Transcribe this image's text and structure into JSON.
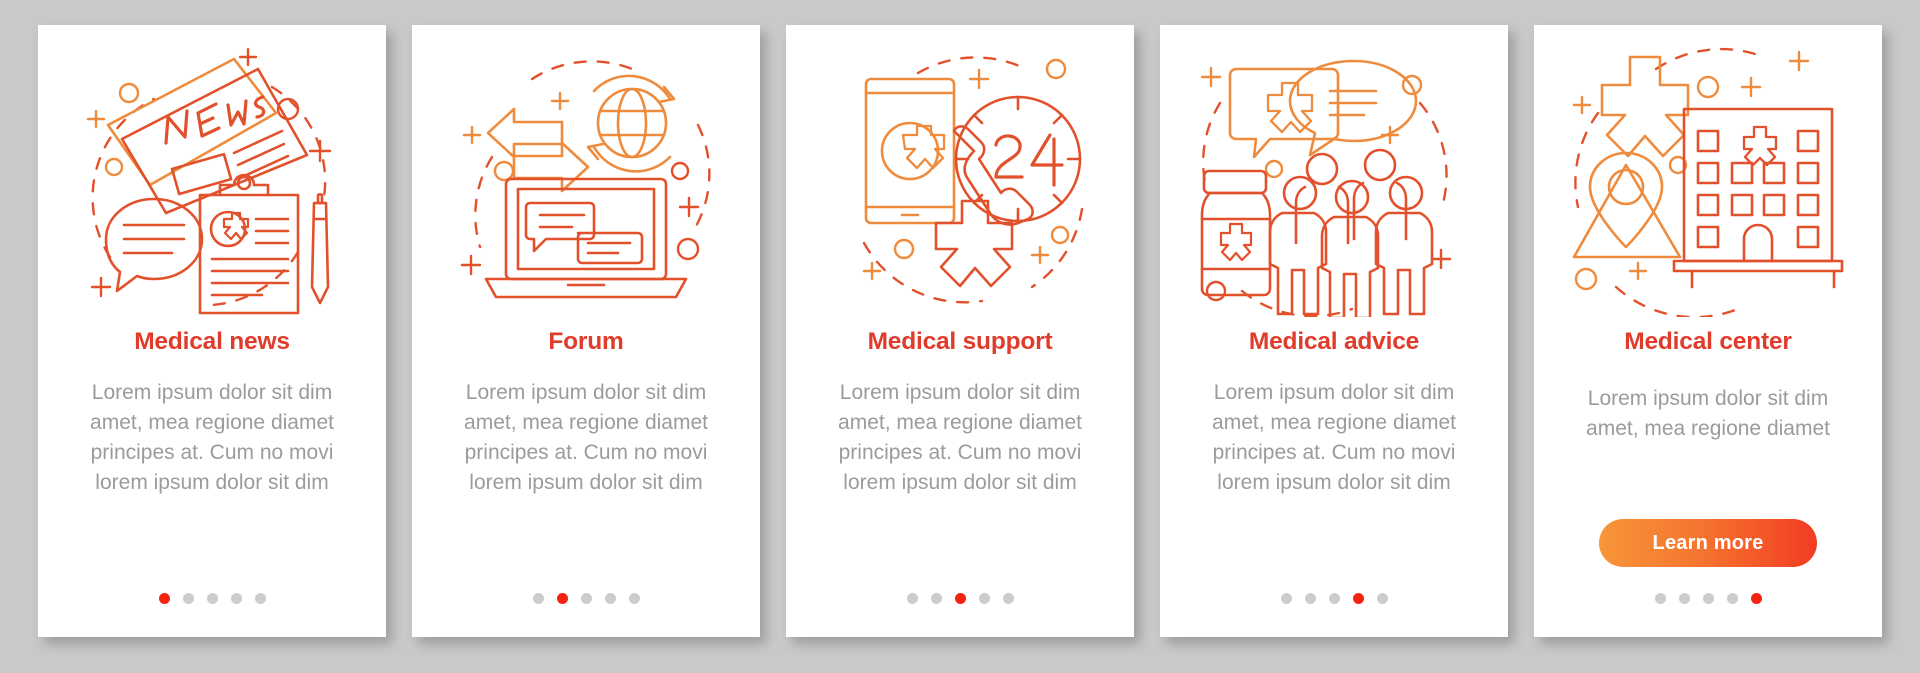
{
  "page": {
    "background_color": "#c9c9c9",
    "card_background": "#ffffff",
    "title_color": "#e13b2b",
    "body_color": "#9b9b9b",
    "dot_active_color": "#f4230f",
    "dot_inactive_color": "#cccccc",
    "button_gradient_from": "#f8953a",
    "button_gradient_to": "#f23c23",
    "illustration_color_light": "#ef8b3c",
    "illustration_color_dark": "#e2512c"
  },
  "cards": [
    {
      "id": "medical-news",
      "illustration": "newspaper-clipboard-speech-bubble-pen-icon",
      "illustration_label": "NEWS",
      "title": "Medical news",
      "body": "Lorem ipsum dolor sit dim amet, mea regione diamet principes at. Cum no movi lorem ipsum dolor sit dim",
      "dots": {
        "count": 5,
        "active_index": 0
      },
      "cta": null
    },
    {
      "id": "forum",
      "illustration": "arrows-globe-laptop-chat-icon",
      "title": "Forum",
      "body": "Lorem ipsum dolor sit dim amet, mea regione diamet principes at. Cum no movi lorem ipsum dolor sit dim",
      "dots": {
        "count": 5,
        "active_index": 1
      },
      "cta": null
    },
    {
      "id": "medical-support",
      "illustration": "smartphone-clock-24-handset-star-of-life-icon",
      "illustration_label": "24",
      "title": "Medical support",
      "body": "Lorem ipsum dolor sit dim amet, mea regione diamet principes at. Cum no movi lorem ipsum dolor sit dim",
      "dots": {
        "count": 5,
        "active_index": 2
      },
      "cta": null
    },
    {
      "id": "medical-advice",
      "illustration": "speech-bubbles-pill-bottle-people-group-icon",
      "title": "Medical advice",
      "body": "Lorem ipsum dolor sit dim amet, mea regione diamet principes at. Cum no movi lorem ipsum dolor sit dim",
      "dots": {
        "count": 5,
        "active_index": 3
      },
      "cta": null
    },
    {
      "id": "medical-center",
      "illustration": "star-of-life-map-pin-hospital-building-icon",
      "title": "Medical center",
      "body": "Lorem ipsum dolor sit dim amet, mea regione diamet",
      "dots": {
        "count": 5,
        "active_index": 4
      },
      "cta": "Learn more"
    }
  ]
}
